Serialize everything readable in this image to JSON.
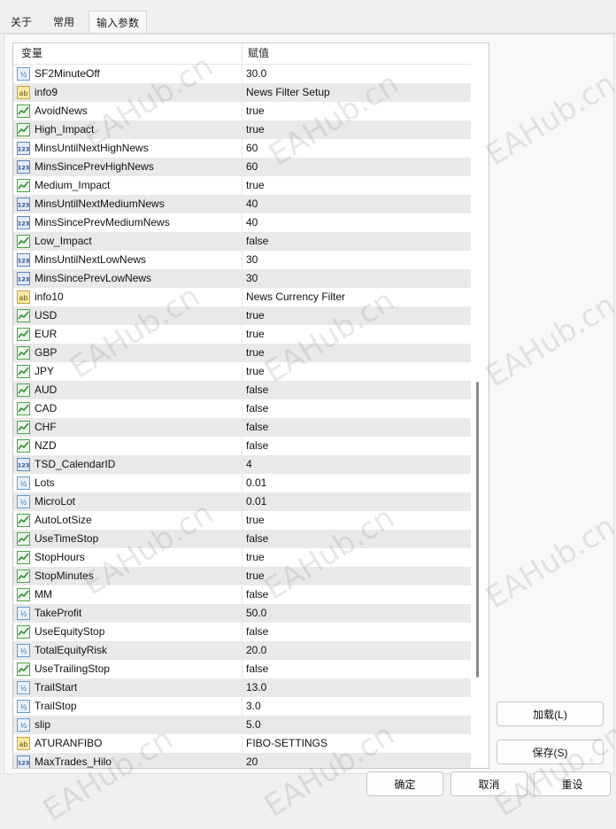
{
  "tabs": [
    {
      "label": "关于",
      "active": false
    },
    {
      "label": "常用",
      "active": false
    },
    {
      "label": "输入参数",
      "active": true
    }
  ],
  "grid": {
    "col_variable": "变量",
    "col_value": "赋值",
    "rows": [
      {
        "name": "SF2MinuteOff",
        "value": "30.0",
        "icon": "double-icon",
        "icon_text": "1/2"
      },
      {
        "name": "info9",
        "value": "News Filter Setup",
        "icon": "string-icon",
        "icon_text": "ab"
      },
      {
        "name": "AvoidNews",
        "value": "true",
        "icon": "bool-icon",
        "icon_text": ""
      },
      {
        "name": "High_Impact",
        "value": "true",
        "icon": "bool-icon",
        "icon_text": ""
      },
      {
        "name": "MinsUntilNextHighNews",
        "value": "60",
        "icon": "int-icon",
        "icon_text": "123"
      },
      {
        "name": "MinsSincePrevHighNews",
        "value": "60",
        "icon": "int-icon",
        "icon_text": "123"
      },
      {
        "name": "Medium_Impact",
        "value": "true",
        "icon": "bool-icon",
        "icon_text": ""
      },
      {
        "name": "MinsUntilNextMediumNews",
        "value": "40",
        "icon": "int-icon",
        "icon_text": "123"
      },
      {
        "name": "MinsSincePrevMediumNews",
        "value": "40",
        "icon": "int-icon",
        "icon_text": "123"
      },
      {
        "name": "Low_Impact",
        "value": "false",
        "icon": "bool-icon",
        "icon_text": ""
      },
      {
        "name": "MinsUntilNextLowNews",
        "value": "30",
        "icon": "int-icon",
        "icon_text": "123"
      },
      {
        "name": "MinsSincePrevLowNews",
        "value": "30",
        "icon": "int-icon",
        "icon_text": "123"
      },
      {
        "name": "info10",
        "value": "News Currency Filter",
        "icon": "string-icon",
        "icon_text": "ab"
      },
      {
        "name": "USD",
        "value": "true",
        "icon": "bool-icon",
        "icon_text": ""
      },
      {
        "name": "EUR",
        "value": "true",
        "icon": "bool-icon",
        "icon_text": ""
      },
      {
        "name": "GBP",
        "value": "true",
        "icon": "bool-icon",
        "icon_text": ""
      },
      {
        "name": "JPY",
        "value": "true",
        "icon": "bool-icon",
        "icon_text": ""
      },
      {
        "name": "AUD",
        "value": "false",
        "icon": "bool-icon",
        "icon_text": ""
      },
      {
        "name": "CAD",
        "value": "false",
        "icon": "bool-icon",
        "icon_text": ""
      },
      {
        "name": "CHF",
        "value": "false",
        "icon": "bool-icon",
        "icon_text": ""
      },
      {
        "name": "NZD",
        "value": "false",
        "icon": "bool-icon",
        "icon_text": ""
      },
      {
        "name": "TSD_CalendarID",
        "value": "4",
        "icon": "int-icon",
        "icon_text": "123"
      },
      {
        "name": "Lots",
        "value": "0.01",
        "icon": "double-icon",
        "icon_text": "1/2"
      },
      {
        "name": "MicroLot",
        "value": "0.01",
        "icon": "double-icon",
        "icon_text": "1/2"
      },
      {
        "name": "AutoLotSize",
        "value": "true",
        "icon": "bool-icon",
        "icon_text": ""
      },
      {
        "name": "UseTimeStop",
        "value": "false",
        "icon": "bool-icon",
        "icon_text": ""
      },
      {
        "name": "StopHours",
        "value": "true",
        "icon": "bool-icon",
        "icon_text": ""
      },
      {
        "name": "StopMinutes",
        "value": "true",
        "icon": "bool-icon",
        "icon_text": ""
      },
      {
        "name": "MM",
        "value": "false",
        "icon": "bool-icon",
        "icon_text": ""
      },
      {
        "name": "TakeProfit",
        "value": "50.0",
        "icon": "double-icon",
        "icon_text": "1/2"
      },
      {
        "name": "UseEquityStop",
        "value": "false",
        "icon": "bool-icon",
        "icon_text": ""
      },
      {
        "name": "TotalEquityRisk",
        "value": "20.0",
        "icon": "double-icon",
        "icon_text": "1/2"
      },
      {
        "name": "UseTrailingStop",
        "value": "false",
        "icon": "bool-icon",
        "icon_text": ""
      },
      {
        "name": "TrailStart",
        "value": "13.0",
        "icon": "double-icon",
        "icon_text": "1/2"
      },
      {
        "name": "TrailStop",
        "value": "3.0",
        "icon": "double-icon",
        "icon_text": "1/2"
      },
      {
        "name": "slip",
        "value": "5.0",
        "icon": "double-icon",
        "icon_text": "1/2"
      },
      {
        "name": "ATURANFIBO",
        "value": "FIBO-SETTINGS",
        "icon": "string-icon",
        "icon_text": "ab"
      },
      {
        "name": "MaxTrades_Hilo",
        "value": "20",
        "icon": "int-icon",
        "icon_text": "123"
      }
    ]
  },
  "buttons": {
    "load": "加载(L)",
    "save": "保存(S)",
    "ok": "确定",
    "cancel": "取消",
    "reset": "重设"
  },
  "watermark": "EAHub.cn",
  "colors": {
    "row_alt": "#e9e9e9",
    "bool_icon": "#4aa64a",
    "int_icon": "#5a85c5",
    "double_icon": "#62a0d0",
    "string_icon": "#c9a43a"
  }
}
